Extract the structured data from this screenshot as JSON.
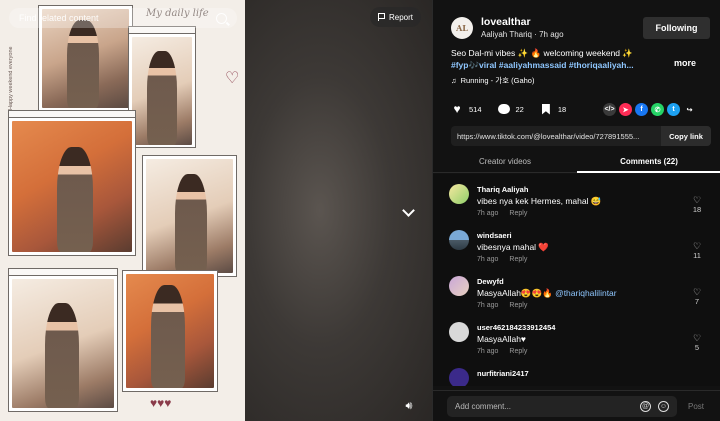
{
  "search": {
    "placeholder": "Find related content"
  },
  "video": {
    "report_label": "Report",
    "poster_title": "My daily life",
    "poster_side_text": "Happy weekend everyone"
  },
  "author": {
    "initials": "AL",
    "handle": "lovealthar",
    "name_time": "Aaliyah Thariq · 7h ago",
    "follow_label": "Following"
  },
  "caption": {
    "text": "Seo Dal-mi vibes ✨ 🔥 welcoming weekend ✨",
    "tags": "#fyp🎶viral #aaliyahmassaid #thoriqaaliyah...",
    "more_label": "more",
    "music": "Running - 가호 (Gaho)"
  },
  "stats": {
    "likes": "514",
    "comments": "22",
    "saves": "18"
  },
  "share": {
    "url": "https://www.tiktok.com/@lovealthar/video/727891555...",
    "copy_label": "Copy link"
  },
  "tabs": [
    {
      "label": "Creator videos"
    },
    {
      "label": "Comments (22)"
    }
  ],
  "comments": [
    {
      "user": "Thariq Aaliyah",
      "text": "vibes nya kek Hermes, mahal 😅",
      "time": "7h ago",
      "reply": "Reply",
      "likes": "18"
    },
    {
      "user": "windsaeri",
      "text": "vibesnya mahal ❤️",
      "time": "7h ago",
      "reply": "Reply",
      "likes": "11"
    },
    {
      "user": "Dewyfd",
      "text": "MasyaAllah😍😍🔥 ",
      "mention": "@thariqhalilintar",
      "time": "7h ago",
      "reply": "Reply",
      "likes": "7"
    },
    {
      "user": "user462184233912454",
      "text": "MasyaAllah♥",
      "time": "7h ago",
      "reply": "Reply",
      "likes": "5"
    },
    {
      "user": "nurfitriani2417",
      "text": "",
      "time": "",
      "reply": "",
      "likes": ""
    }
  ],
  "composer": {
    "placeholder": "Add comment...",
    "post_label": "Post"
  },
  "colors": {
    "accent_link": "#8fc7ff",
    "panel_bg": "#121212"
  }
}
